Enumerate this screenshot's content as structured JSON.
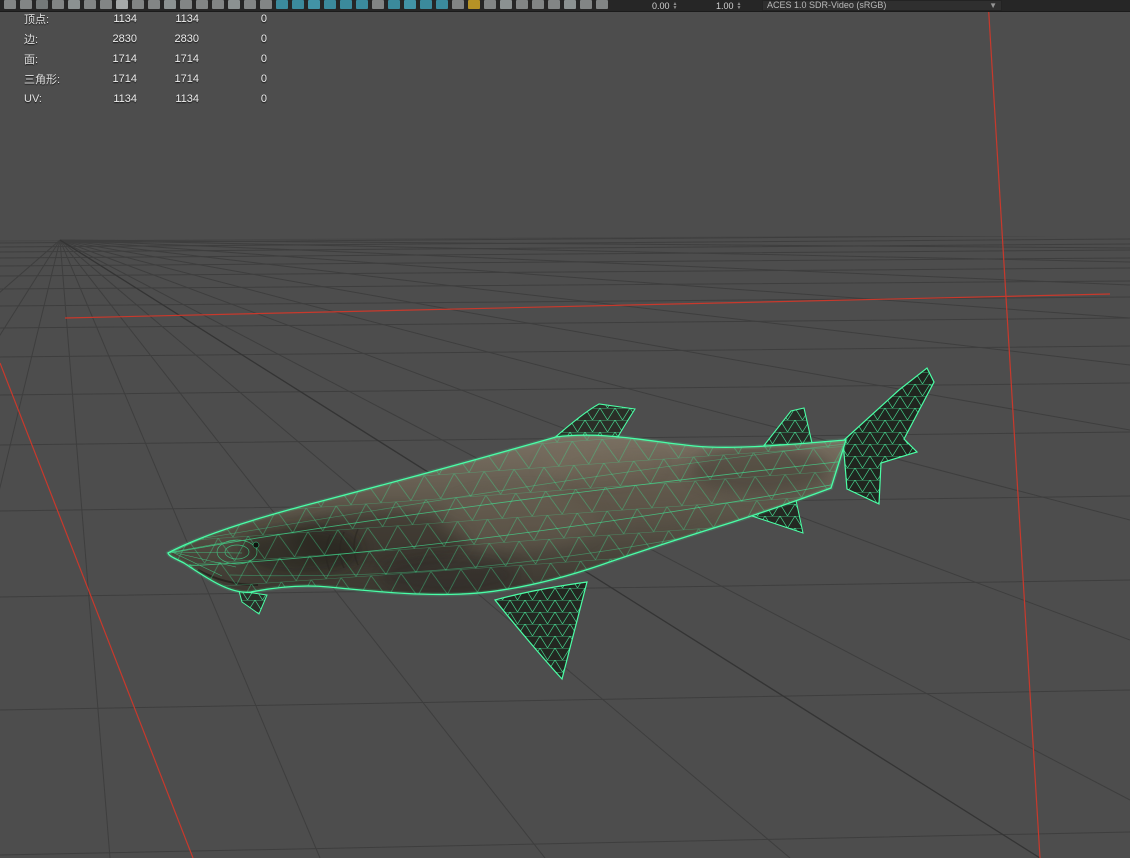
{
  "toolbar": {
    "icon_colors": [
      "#8f9393",
      "#8f9393",
      "#7f8585",
      "#8f9393",
      "#9aa0a0",
      "#8f9393",
      "#8f9393",
      "#b7bcbc",
      "#8f9393",
      "#8f9393",
      "#9aa0a0",
      "#8f9393",
      "#8f9393",
      "#8f9393",
      "#9aa0a0",
      "#8f9393",
      "#8f9393",
      "#3f98ad",
      "#3f98ad",
      "#47a3b8",
      "#3f98ad",
      "#3f98ad",
      "#3f98ad",
      "#8f9393",
      "#3f98ad",
      "#47a3b8",
      "#3f98ad",
      "#3f98ad",
      "#8f9393",
      "#c9a227",
      "#8f9393",
      "#9aa0a0",
      "#8f9393",
      "#8f9393",
      "#8f9393",
      "#9aa0a0",
      "#8f9393",
      "#8f9393"
    ],
    "fields": [
      {
        "value": "0.00"
      },
      {
        "value": "1.00"
      }
    ],
    "colorspace": {
      "value": "ACES 1.0 SDR-Video (sRGB)"
    },
    "spinner_up": "▲",
    "spinner_down": "▼",
    "chevron": "▼"
  },
  "hud": {
    "rows": [
      {
        "label": "顶点:",
        "total": "1134",
        "selected": "1134",
        "component": "0"
      },
      {
        "label": "边:",
        "total": "2830",
        "selected": "2830",
        "component": "0"
      },
      {
        "label": "面:",
        "total": "1714",
        "selected": "1714",
        "component": "0"
      },
      {
        "label": "三角形:",
        "total": "1714",
        "selected": "1714",
        "component": "0"
      },
      {
        "label": "UV:",
        "total": "1134",
        "selected": "1134",
        "component": "0"
      }
    ]
  },
  "viewport": {
    "background": "#4d4d4d",
    "grid_line": "#3e3e3e",
    "grid_axis_dark": "#343434",
    "wireframe_green": "#49ffa8",
    "frustum_red": "#c8392c"
  }
}
